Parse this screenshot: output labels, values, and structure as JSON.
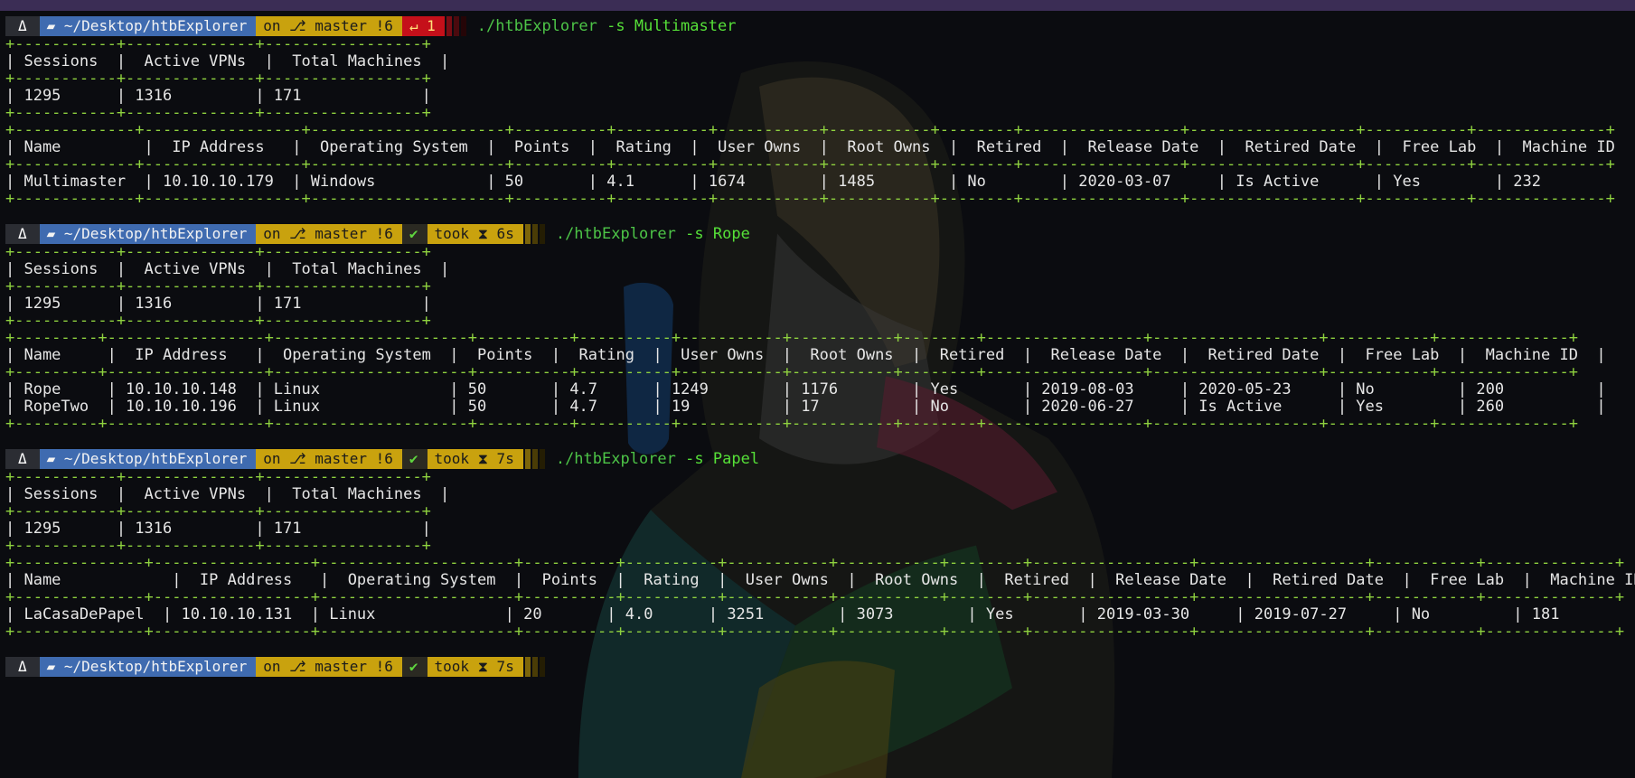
{
  "prompt": {
    "os_icon": "penguin-icon",
    "dir": "~/Desktop/htbExplorer",
    "git_prefix": "on",
    "git_icon": "branch-icon",
    "git_branch": "master !6",
    "colors": {
      "dir_bg": "#3f6bb0",
      "git_bg": "#c9a20e",
      "err_bg": "#c5101a",
      "accent": "#5fd43f"
    }
  },
  "runs": [
    {
      "status_kind": "error",
      "status_text": "↵ 1",
      "cmd_path": "./htbExplorer",
      "cmd_flag": "-s",
      "cmd_arg": "Multimaster",
      "summary": {
        "border": "+-----------+--------------+-----------------+",
        "header": "| Sessions  |  Active VPNs  |  Total Machines  |",
        "row": "| 1295      | 1316         | 171             |"
      },
      "machines": {
        "border": "+-------------+-----------------+---------------------+----------+----------+-----------+-----------+--------+-----------------+------------------+-----------+--------------+",
        "header": "| Name         |  IP Address   |  Operating System  |  Points  |  Rating  |  User Owns  |  Root Owns  |  Retired  |  Release Date  |  Retired Date  |  Free Lab  |  Machine ID  |",
        "rows": [
          "| Multimaster  | 10.10.10.179  | Windows            | 50       | 4.1      | 1674        | 1485        | No        | 2020-03-07     | Is Active      | Yes        | 232          |"
        ]
      }
    },
    {
      "status_kind": "ok",
      "status_text": "✔",
      "took_text": "took ⧗ 6s",
      "cmd_path": "./htbExplorer",
      "cmd_flag": "-s",
      "cmd_arg": "Rope",
      "summary": {
        "border": "+-----------+--------------+-----------------+",
        "header": "| Sessions  |  Active VPNs  |  Total Machines  |",
        "row": "| 1295      | 1316         | 171             |"
      },
      "machines": {
        "border": "+---------+-----------------+---------------------+----------+----------+-----------+-----------+--------+-----------------+------------------+-----------+--------------+",
        "header": "| Name     |  IP Address   |  Operating System  |  Points  |  Rating  |  User Owns  |  Root Owns  |  Retired  |  Release Date  |  Retired Date  |  Free Lab  |  Machine ID  |",
        "rows": [
          "| Rope     | 10.10.10.148  | Linux              | 50       | 4.7      | 1249        | 1176        | Yes       | 2019-08-03     | 2020-05-23     | No         | 200          |",
          "| RopeTwo  | 10.10.10.196  | Linux              | 50       | 4.7      | 19          | 17          | No        | 2020-06-27     | Is Active      | Yes        | 260          |"
        ]
      }
    },
    {
      "status_kind": "ok",
      "status_text": "✔",
      "took_text": "took ⧗ 7s",
      "cmd_path": "./htbExplorer",
      "cmd_flag": "-s",
      "cmd_arg": "Papel",
      "summary": {
        "border": "+-----------+--------------+-----------------+",
        "header": "| Sessions  |  Active VPNs  |  Total Machines  |",
        "row": "| 1295      | 1316         | 171             |"
      },
      "machines": {
        "border": "+--------------+-----------------+---------------------+----------+----------+-----------+-----------+--------+-----------------+------------------+-----------+--------------+",
        "header": "| Name            |  IP Address   |  Operating System  |  Points  |  Rating  |  User Owns  |  Root Owns  |  Retired  |  Release Date  |  Retired Date  |  Free Lab  |  Machine ID  |",
        "rows": [
          "| LaCasaDePapel  | 10.10.10.131  | Linux              | 20       | 4.0      | 3251        | 3073        | Yes       | 2019-03-30     | 2019-07-27     | No         | 181          |"
        ]
      }
    }
  ],
  "final_prompt": {
    "status_text": "✔",
    "took_text": "took ⧗ 7s"
  }
}
